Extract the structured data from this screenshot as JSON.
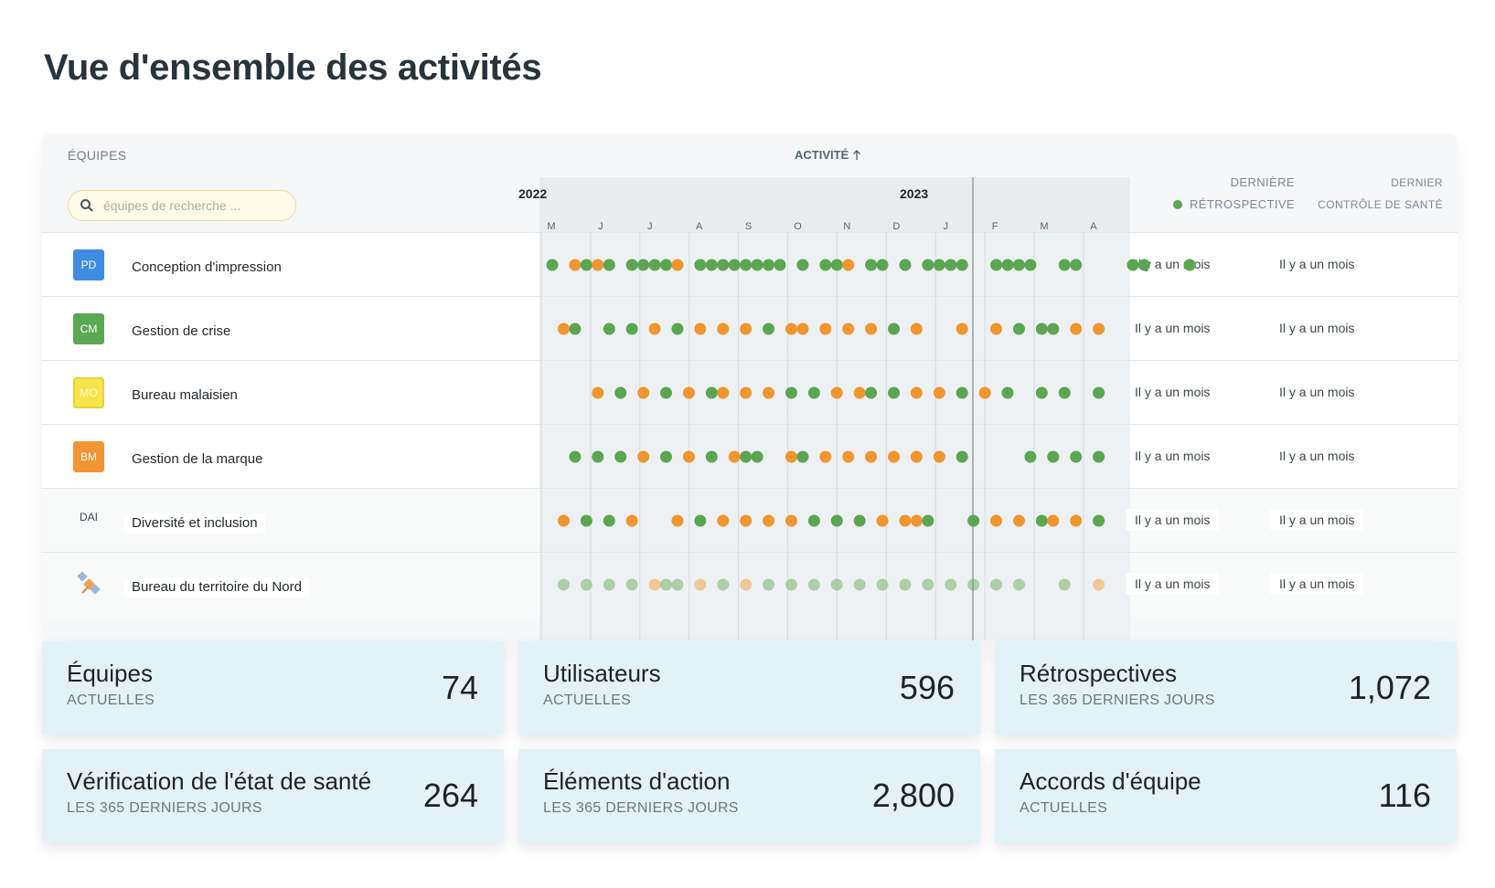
{
  "title": "Vue d'ensemble des activités",
  "table": {
    "teams_header": "ÉQUIPES",
    "activity_header": "ACTIVITÉ",
    "search_placeholder": "équipes de recherche ...",
    "years": [
      "2022",
      "2023"
    ],
    "months": [
      "M",
      "J",
      "J",
      "A",
      "S",
      "O",
      "N",
      "D",
      "J",
      "F",
      "M",
      "A"
    ],
    "col_retro_line1": "DERNIÈRE",
    "col_retro_line2": "RÉTROSPECTIVE",
    "col_health_line1": "DERNIER",
    "col_health_line2": "CONTRÔLE DE SANTÉ",
    "colors": {
      "retro": "#5ba651",
      "health": "#f0962e"
    },
    "rows": [
      {
        "badge": "PD",
        "badge_color": "#3f8de2",
        "name": "Conception d'impression",
        "retro": "Il y a un mois",
        "health": "Il y a un mois"
      },
      {
        "badge": "CM",
        "badge_color": "#5aa853",
        "name": "Gestion de crise",
        "retro": "Il y a un mois",
        "health": "Il y a un mois"
      },
      {
        "badge": "MO",
        "badge_color": "#f6e44b",
        "name": "Bureau malaisien",
        "retro": "Il y a un mois",
        "health": "Il y a un mois"
      },
      {
        "badge": "BM",
        "badge_color": "#f29432",
        "name": "Gestion de la marque",
        "retro": "Il y a un mois",
        "health": "Il y a un mois"
      },
      {
        "badge": "DAI",
        "badge_color": "",
        "name": "Diversité et inclusion",
        "retro": "Il y a un mois",
        "health": "Il y a un mois"
      },
      {
        "badge": "",
        "badge_color": "",
        "name": "Bureau du territoire du Nord",
        "retro": "Il y a un mois",
        "health": "Il y a un mois"
      }
    ]
  },
  "stats": [
    {
      "title": "Équipes",
      "sub": "ACTUELLES",
      "value": "74"
    },
    {
      "title": "Utilisateurs",
      "sub": "ACTUELLES",
      "value": "596"
    },
    {
      "title": "Rétrospectives",
      "sub": "LES 365 DERNIERS JOURS",
      "value": "1,072"
    },
    {
      "title": "Vérification de l'état de santé",
      "sub": "LES 365 DERNIERS JOURS",
      "value": "264"
    },
    {
      "title": "Éléments d'action",
      "sub": "LES 365 DERNIERS JOURS",
      "value": "2,800"
    },
    {
      "title": "Accords d'équipe",
      "sub": "ACTUELLES",
      "value": "116"
    }
  ],
  "chart_data": {
    "type": "scatter",
    "x_unit": "week index from start of May 2022",
    "series": [
      {
        "team": "Conception d'impression",
        "events": [
          [
            "g",
            0
          ],
          [
            "o",
            2
          ],
          [
            "g",
            3
          ],
          [
            "o",
            4
          ],
          [
            "g",
            5
          ],
          [
            "g",
            7
          ],
          [
            "g",
            8
          ],
          [
            "g",
            9
          ],
          [
            "g",
            10
          ],
          [
            "o",
            11
          ],
          [
            "g",
            13
          ],
          [
            "g",
            14
          ],
          [
            "g",
            15
          ],
          [
            "g",
            16
          ],
          [
            "g",
            17
          ],
          [
            "g",
            18
          ],
          [
            "g",
            19
          ],
          [
            "g",
            20
          ],
          [
            "g",
            22
          ],
          [
            "g",
            24
          ],
          [
            "g",
            25
          ],
          [
            "o",
            26
          ],
          [
            "g",
            28
          ],
          [
            "g",
            29
          ],
          [
            "g",
            31
          ],
          [
            "g",
            33
          ],
          [
            "g",
            34
          ],
          [
            "g",
            35
          ],
          [
            "g",
            36
          ],
          [
            "g",
            39
          ],
          [
            "g",
            40
          ],
          [
            "g",
            41
          ],
          [
            "g",
            42
          ],
          [
            "g",
            45
          ],
          [
            "g",
            46
          ],
          [
            "g",
            51
          ],
          [
            "g",
            52
          ],
          [
            "g",
            56
          ]
        ]
      },
      {
        "team": "Gestion de crise",
        "events": [
          [
            "o",
            1
          ],
          [
            "g",
            2
          ],
          [
            "g",
            5
          ],
          [
            "g",
            7
          ],
          [
            "o",
            9
          ],
          [
            "g",
            11
          ],
          [
            "o",
            13
          ],
          [
            "o",
            15
          ],
          [
            "o",
            17
          ],
          [
            "g",
            19
          ],
          [
            "o",
            21
          ],
          [
            "o",
            22
          ],
          [
            "o",
            24
          ],
          [
            "o",
            26
          ],
          [
            "o",
            28
          ],
          [
            "g",
            30
          ],
          [
            "o",
            32
          ],
          [
            "o",
            36
          ],
          [
            "o",
            39
          ],
          [
            "g",
            41
          ],
          [
            "g",
            43
          ],
          [
            "g",
            44
          ],
          [
            "o",
            46
          ],
          [
            "o",
            48
          ]
        ]
      },
      {
        "team": "Bureau malaisien",
        "events": [
          [
            "o",
            4
          ],
          [
            "g",
            6
          ],
          [
            "o",
            8
          ],
          [
            "g",
            10
          ],
          [
            "o",
            12
          ],
          [
            "g",
            14
          ],
          [
            "o",
            15
          ],
          [
            "o",
            17
          ],
          [
            "o",
            19
          ],
          [
            "g",
            21
          ],
          [
            "g",
            23
          ],
          [
            "o",
            25
          ],
          [
            "o",
            27
          ],
          [
            "g",
            28
          ],
          [
            "g",
            30
          ],
          [
            "o",
            32
          ],
          [
            "o",
            34
          ],
          [
            "g",
            36
          ],
          [
            "o",
            38
          ],
          [
            "g",
            40
          ],
          [
            "g",
            43
          ],
          [
            "g",
            45
          ],
          [
            "g",
            48
          ]
        ]
      },
      {
        "team": "Gestion de la marque",
        "events": [
          [
            "g",
            2
          ],
          [
            "g",
            4
          ],
          [
            "g",
            6
          ],
          [
            "o",
            8
          ],
          [
            "g",
            10
          ],
          [
            "o",
            12
          ],
          [
            "g",
            14
          ],
          [
            "o",
            16
          ],
          [
            "g",
            17
          ],
          [
            "g",
            18
          ],
          [
            "o",
            21
          ],
          [
            "g",
            22
          ],
          [
            "o",
            24
          ],
          [
            "o",
            26
          ],
          [
            "o",
            28
          ],
          [
            "o",
            30
          ],
          [
            "o",
            32
          ],
          [
            "o",
            34
          ],
          [
            "g",
            36
          ],
          [
            "g",
            42
          ],
          [
            "g",
            44
          ],
          [
            "g",
            46
          ],
          [
            "g",
            48
          ]
        ]
      },
      {
        "team": "Diversité et inclusion",
        "events": [
          [
            "o",
            1
          ],
          [
            "g",
            3
          ],
          [
            "g",
            5
          ],
          [
            "o",
            7
          ],
          [
            "o",
            11
          ],
          [
            "g",
            13
          ],
          [
            "o",
            15
          ],
          [
            "o",
            17
          ],
          [
            "o",
            19
          ],
          [
            "o",
            21
          ],
          [
            "g",
            23
          ],
          [
            "g",
            25
          ],
          [
            "g",
            27
          ],
          [
            "o",
            29
          ],
          [
            "o",
            31
          ],
          [
            "o",
            32
          ],
          [
            "g",
            33
          ],
          [
            "g",
            37
          ],
          [
            "o",
            39
          ],
          [
            "o",
            41
          ],
          [
            "g",
            43
          ],
          [
            "o",
            44
          ],
          [
            "o",
            46
          ],
          [
            "g",
            48
          ]
        ]
      },
      {
        "team": "Bureau du territoire du Nord",
        "events": [
          [
            "g",
            1
          ],
          [
            "g",
            3
          ],
          [
            "g",
            5
          ],
          [
            "g",
            7
          ],
          [
            "o",
            9
          ],
          [
            "g",
            10
          ],
          [
            "g",
            11
          ],
          [
            "o",
            13
          ],
          [
            "g",
            15
          ],
          [
            "o",
            17
          ],
          [
            "g",
            19
          ],
          [
            "g",
            21
          ],
          [
            "g",
            23
          ],
          [
            "g",
            25
          ],
          [
            "g",
            27
          ],
          [
            "g",
            29
          ],
          [
            "g",
            31
          ],
          [
            "g",
            33
          ],
          [
            "g",
            35
          ],
          [
            "g",
            37
          ],
          [
            "g",
            39
          ],
          [
            "g",
            41
          ],
          [
            "g",
            45
          ],
          [
            "o",
            48
          ]
        ]
      }
    ]
  }
}
